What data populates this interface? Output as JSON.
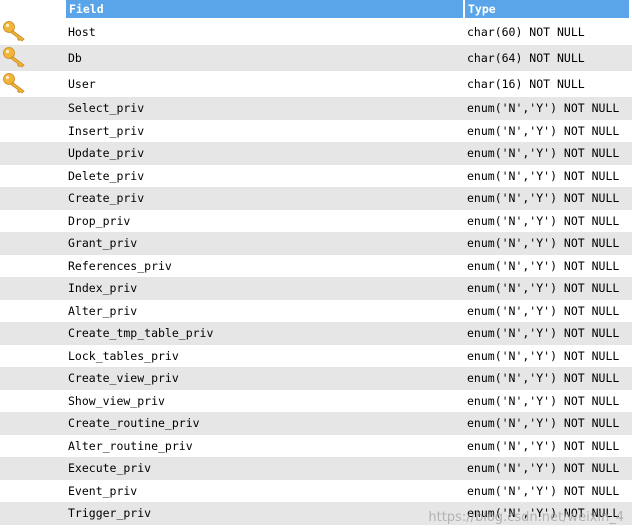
{
  "table": {
    "headers": {
      "field": "Field",
      "type": "Type"
    },
    "rows": [
      {
        "field": "Host",
        "type": "char(60) NOT NULL",
        "key": true
      },
      {
        "field": "Db",
        "type": "char(64) NOT NULL",
        "key": true
      },
      {
        "field": "User",
        "type": "char(16) NOT NULL",
        "key": true
      },
      {
        "field": "Select_priv",
        "type": "enum('N','Y') NOT NULL",
        "key": false
      },
      {
        "field": "Insert_priv",
        "type": "enum('N','Y') NOT NULL",
        "key": false
      },
      {
        "field": "Update_priv",
        "type": "enum('N','Y') NOT NULL",
        "key": false
      },
      {
        "field": "Delete_priv",
        "type": "enum('N','Y') NOT NULL",
        "key": false
      },
      {
        "field": "Create_priv",
        "type": "enum('N','Y') NOT NULL",
        "key": false
      },
      {
        "field": "Drop_priv",
        "type": "enum('N','Y') NOT NULL",
        "key": false
      },
      {
        "field": "Grant_priv",
        "type": "enum('N','Y') NOT NULL",
        "key": false
      },
      {
        "field": "References_priv",
        "type": "enum('N','Y') NOT NULL",
        "key": false
      },
      {
        "field": "Index_priv",
        "type": "enum('N','Y') NOT NULL",
        "key": false
      },
      {
        "field": "Alter_priv",
        "type": "enum('N','Y') NOT NULL",
        "key": false
      },
      {
        "field": "Create_tmp_table_priv",
        "type": "enum('N','Y') NOT NULL",
        "key": false
      },
      {
        "field": "Lock_tables_priv",
        "type": "enum('N','Y') NOT NULL",
        "key": false
      },
      {
        "field": "Create_view_priv",
        "type": "enum('N','Y') NOT NULL",
        "key": false
      },
      {
        "field": "Show_view_priv",
        "type": "enum('N','Y') NOT NULL",
        "key": false
      },
      {
        "field": "Create_routine_priv",
        "type": "enum('N','Y') NOT NULL",
        "key": false
      },
      {
        "field": "Alter_routine_priv",
        "type": "enum('N','Y') NOT NULL",
        "key": false
      },
      {
        "field": "Execute_priv",
        "type": "enum('N','Y') NOT NULL",
        "key": false
      },
      {
        "field": "Event_priv",
        "type": "enum('N','Y') NOT NULL",
        "key": false
      },
      {
        "field": "Trigger_priv",
        "type": "enum('N','Y') NOT NULL",
        "key": false
      }
    ]
  },
  "watermark": "https://blog.csdn.net/weixin_4",
  "colors": {
    "header_bg": "#5aa5e9",
    "stripe": "#e6e6e6",
    "key_icon": "#f3b43c"
  }
}
